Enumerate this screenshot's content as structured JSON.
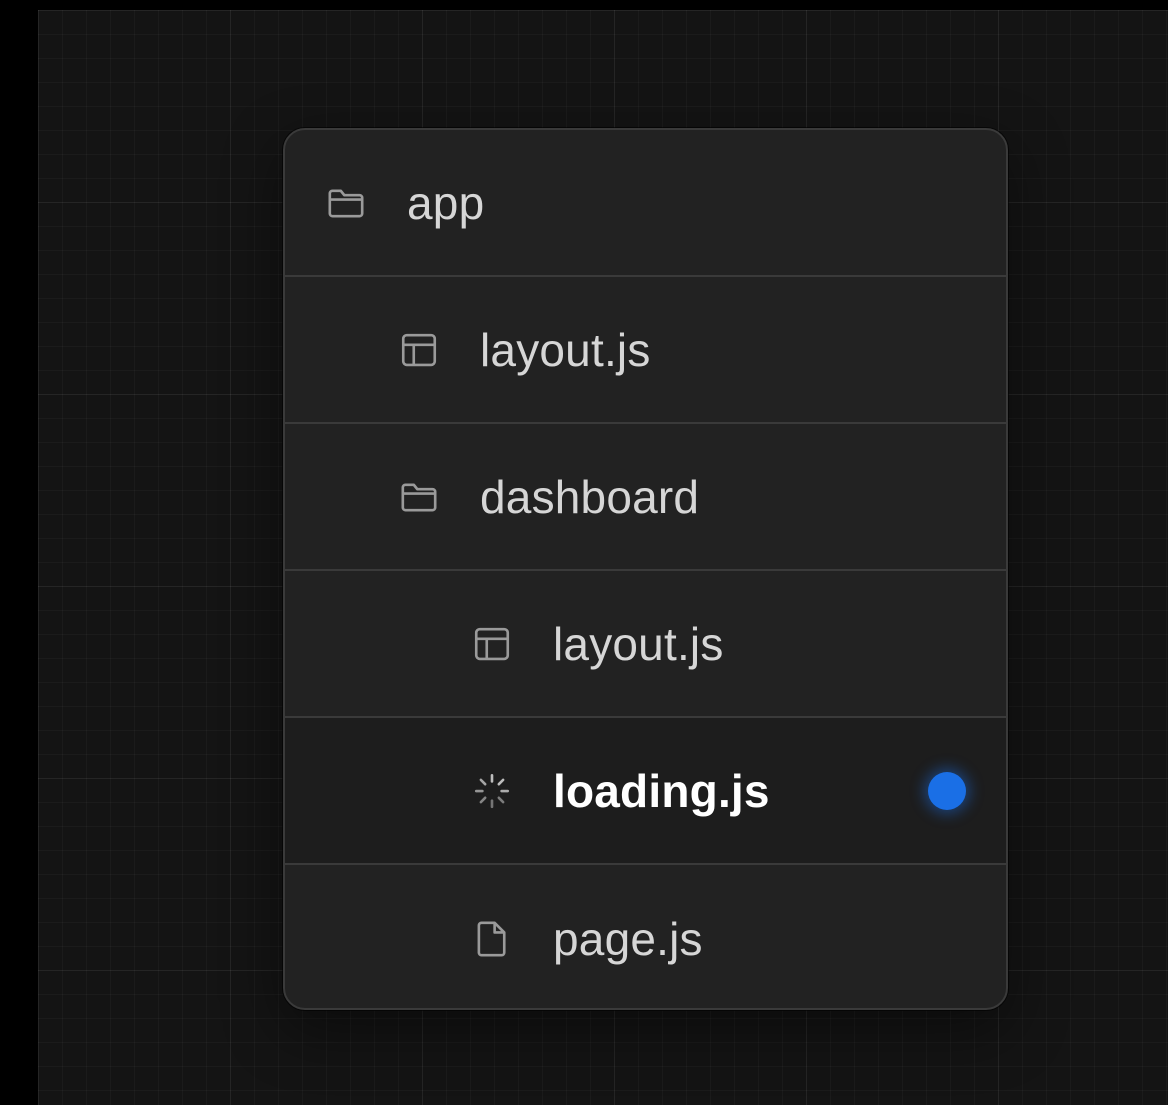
{
  "tree": {
    "items": [
      {
        "label": "app",
        "icon": "folder-icon",
        "level": 0,
        "active": false
      },
      {
        "label": "layout.js",
        "icon": "layout-icon",
        "level": 1,
        "active": false
      },
      {
        "label": "dashboard",
        "icon": "folder-icon",
        "level": 1,
        "active": false
      },
      {
        "label": "layout.js",
        "icon": "layout-icon",
        "level": 2,
        "active": false
      },
      {
        "label": "loading.js",
        "icon": "loading-spinner-icon",
        "level": 2,
        "active": true
      },
      {
        "label": "page.js",
        "icon": "file-icon",
        "level": 2,
        "active": false
      }
    ]
  },
  "colors": {
    "accent": "#1a6fe6",
    "background": "#141414",
    "panel": "#222222",
    "border": "#3a3a3a",
    "text": "#d6d6d6"
  }
}
